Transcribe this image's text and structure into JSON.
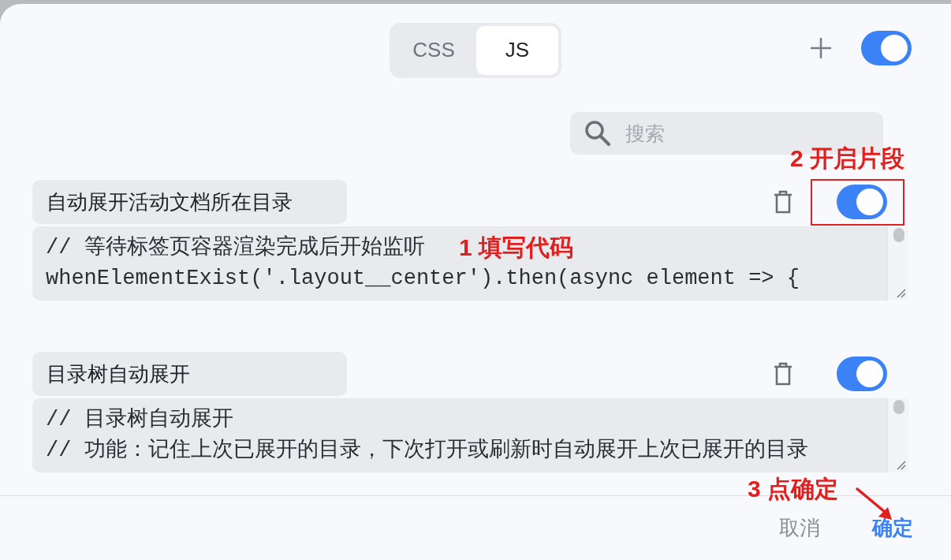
{
  "tabs": [
    {
      "label": "CSS",
      "selected": false
    },
    {
      "label": "JS",
      "selected": true
    }
  ],
  "global_toggle": {
    "on": true
  },
  "search": {
    "placeholder": "搜索"
  },
  "snippets": [
    {
      "title": "自动展开活动文档所在目录",
      "on": true,
      "highlighted": true,
      "annotation": "2 开启片段",
      "code_lines": [
        "// 等待标签页容器渲染完成后开始监听",
        "whenElementExist('.layout__center').then(async element => {"
      ],
      "code_annotation": "1 填写代码"
    },
    {
      "title": "目录树自动展开",
      "on": true,
      "highlighted": false,
      "code_lines": [
        "// 目录树自动展开",
        "// 功能：记住上次已展开的目录，下次打开或刷新时自动展开上次已展开的目录"
      ]
    }
  ],
  "footer": {
    "annotation": "3 点确定",
    "buttons": [
      {
        "label": "取消",
        "kind": "secondary"
      },
      {
        "label": "确定",
        "kind": "primary"
      }
    ]
  }
}
